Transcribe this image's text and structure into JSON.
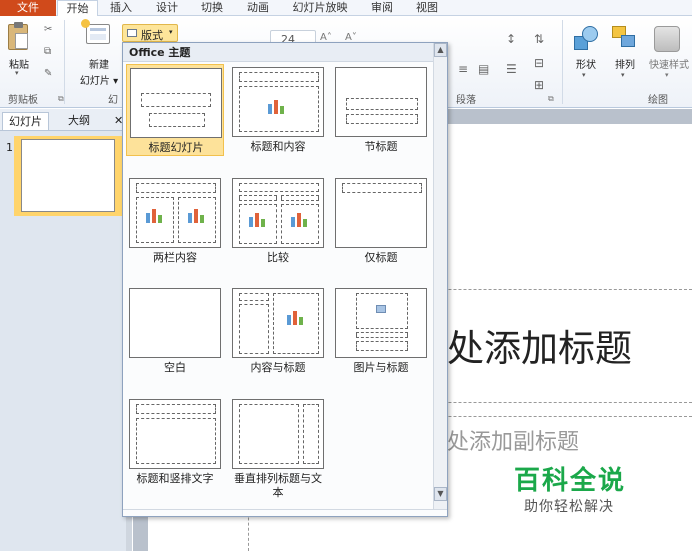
{
  "ribbon_tabs": [
    "文件",
    "开始",
    "插入",
    "设计",
    "切换",
    "动画",
    "幻灯片放映",
    "审阅",
    "视图"
  ],
  "ribbon": {
    "paste_label": "粘贴",
    "new_slide_label_1": "新建",
    "new_slide_label_2": "幻灯片",
    "layout_button_label": "版式",
    "font_size": "24",
    "shape_label": "形状",
    "arrange_label": "排列",
    "quick_style_label": "快速样式",
    "group_clipboard": "剪贴板",
    "group_slides_partial": "幻",
    "group_paragraph": "段落",
    "group_drawing": "绘图"
  },
  "pane_tabs": [
    "幻灯片",
    "大纲"
  ],
  "thumbnail_number": "1",
  "dropdown": {
    "header": "Office 主题",
    "layouts": [
      {
        "label": "标题幻灯片",
        "selected": true
      },
      {
        "label": "标题和内容",
        "selected": false
      },
      {
        "label": "节标题",
        "selected": false
      },
      {
        "label": "两栏内容",
        "selected": false
      },
      {
        "label": "比较",
        "selected": false
      },
      {
        "label": "仅标题",
        "selected": false
      },
      {
        "label": "空白",
        "selected": false
      },
      {
        "label": "内容与标题",
        "selected": false
      },
      {
        "label": "图片与标题",
        "selected": false
      },
      {
        "label": "标题和竖排文字",
        "selected": false
      },
      {
        "label": "垂直排列标题与文本",
        "selected": false
      }
    ]
  },
  "slide": {
    "title_placeholder": "处添加标题",
    "subtitle_placeholder": "处添加副标题"
  },
  "watermark": {
    "main": "百科全说",
    "sub": "助你轻松解决"
  },
  "colors": {
    "file_tab": "#d04a1b",
    "selection": "#fde29a",
    "watermark_green": "#1ba84a"
  }
}
